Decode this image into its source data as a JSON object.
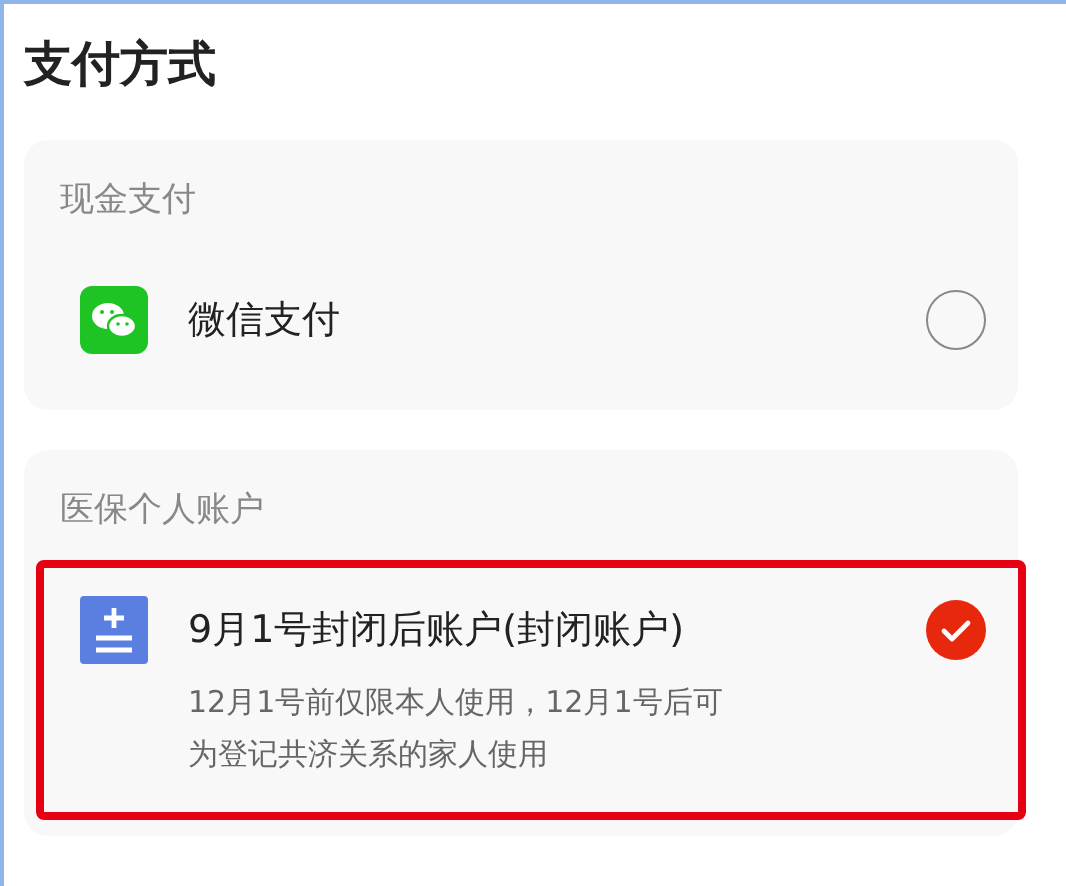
{
  "title": "支付方式",
  "sections": [
    {
      "label": "现金支付",
      "options": [
        {
          "kind": "wechat",
          "name": "微信支付",
          "selected": false,
          "highlighted": false
        }
      ]
    },
    {
      "label": "医保个人账户",
      "options": [
        {
          "kind": "account",
          "name": "9月1号封闭后账户(封闭账户)",
          "description": [
            "12月1号前仅限本人使用，12月1号后可",
            "为登记共济关系的家人使用"
          ],
          "selected": true,
          "highlighted": true
        }
      ]
    }
  ]
}
